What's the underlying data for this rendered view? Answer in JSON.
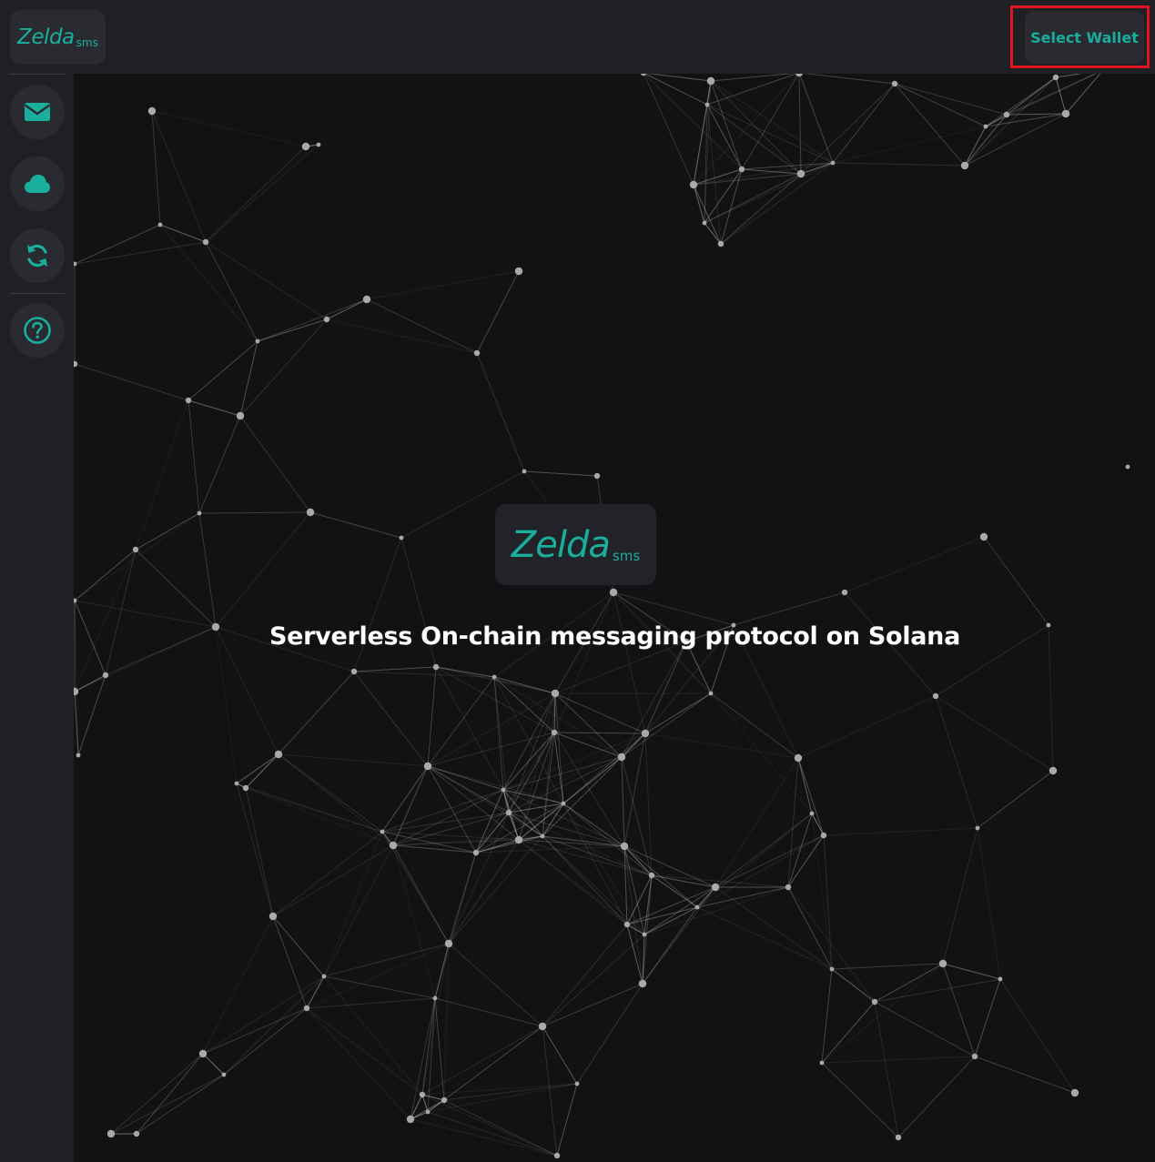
{
  "brand": {
    "name": "Zelda",
    "suffix": "sms",
    "accent_color": "#1aae9d"
  },
  "header": {
    "wallet_button_label": "Select Wallet",
    "highlight_color": "#e0131f"
  },
  "sidebar": {
    "items": [
      {
        "name": "messages",
        "icon": "envelope-icon"
      },
      {
        "name": "storage",
        "icon": "cloud-icon"
      },
      {
        "name": "sync",
        "icon": "refresh-icon"
      },
      {
        "name": "help",
        "icon": "question-circle-icon"
      }
    ]
  },
  "hero": {
    "logo_name": "Zelda",
    "logo_suffix": "sms",
    "tagline": "Serverless On-chain messaging protocol on Solana"
  },
  "theme": {
    "background": "#121214",
    "panel": "#1f2024",
    "button_bg": "#2a2b30"
  }
}
